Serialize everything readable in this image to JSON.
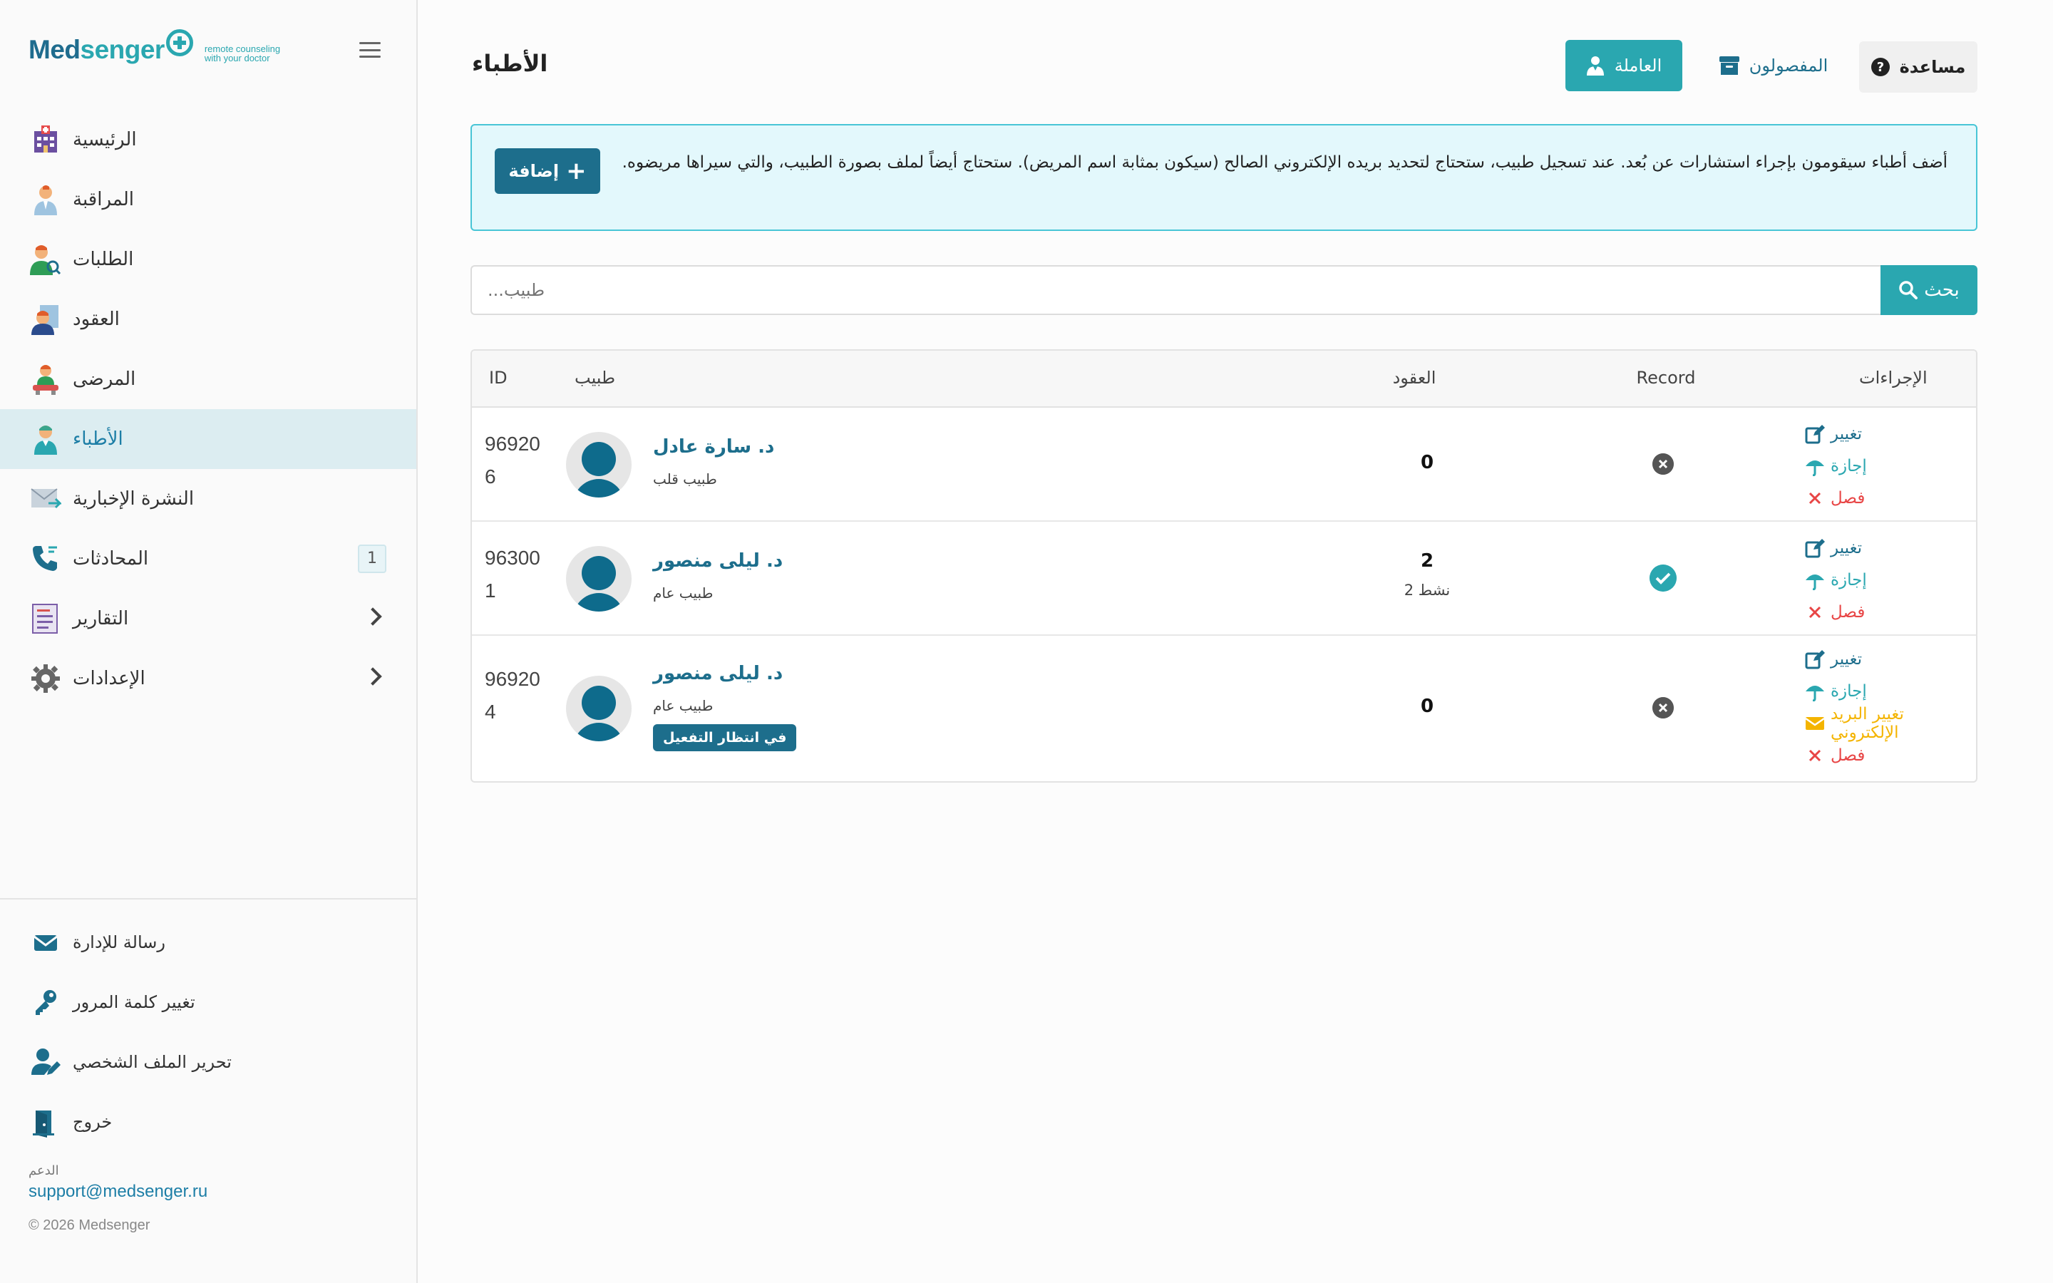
{
  "brand": {
    "word_a": "Med",
    "word_b": "senger",
    "tagline_1": "remote counseling",
    "tagline_2": "with your doctor"
  },
  "nav": [
    {
      "label": "الرئيسية",
      "icon": "hospital-icon"
    },
    {
      "label": "المراقبة",
      "icon": "monitoring-doctor-icon"
    },
    {
      "label": "الطلبات",
      "icon": "requests-icon"
    },
    {
      "label": "العقود",
      "icon": "contracts-icon"
    },
    {
      "label": "المرضى",
      "icon": "patients-icon"
    },
    {
      "label": "الأطباء",
      "icon": "doctors-icon",
      "active": true
    },
    {
      "label": "النشرة الإخبارية",
      "icon": "newsletter-icon"
    },
    {
      "label": "المحادثات",
      "icon": "phone-icon",
      "badge": "1"
    },
    {
      "label": "التقارير",
      "icon": "reports-icon"
    },
    {
      "label": "الإعدادات",
      "icon": "settings-icon"
    }
  ],
  "bottom_nav": [
    {
      "label": "رسالة للإدارة",
      "icon": "envelope-icon"
    },
    {
      "label": "تغيير كلمة المرور",
      "icon": "key-icon"
    },
    {
      "label": "تحرير الملف الشخصي",
      "icon": "user-edit-icon"
    },
    {
      "label": "خروج",
      "icon": "logout-door-icon"
    }
  ],
  "support": {
    "label": "الدعم",
    "email": "support@medsenger.ru",
    "copyright": "© 2026 Medsenger"
  },
  "header": {
    "title": "الأطباء",
    "btn_working": "العاملة",
    "btn_fired": "المفصولون",
    "btn_help": "مساعدة"
  },
  "alert": {
    "text": "أضف أطباء سيقومون بإجراء استشارات عن بُعد. عند تسجيل طبيب، ستحتاج لتحديد بريده الإلكتروني الصالح (سيكون بمثابة اسم المريض). ستحتاج أيضاً لملف بصورة الطبيب، والتي سيراها مريضوه.",
    "add_label": "إضافة"
  },
  "search": {
    "placeholder": "طبيب...",
    "button": "بحث"
  },
  "table": {
    "columns": {
      "id": "ID",
      "doctor": "طبيب",
      "contracts": "العقود",
      "record": "Record",
      "actions": "الإجراءات"
    },
    "rows": [
      {
        "id_1": "96920",
        "id_2": "6",
        "name": "د. سارة عادل",
        "spec": "طبيب قلب",
        "contracts": "0",
        "active": "",
        "record": false,
        "pending": "",
        "actions": {
          "edit": "تغيير",
          "vacation": "إجازة",
          "change_email": "",
          "fire": "فصل"
        }
      },
      {
        "id_1": "96300",
        "id_2": "1",
        "name": "د. ليلى منصور",
        "spec": "طبيب عام",
        "contracts": "2",
        "active": "نشط 2",
        "record": true,
        "pending": "",
        "actions": {
          "edit": "تغيير",
          "vacation": "إجازة",
          "change_email": "",
          "fire": "فصل"
        }
      },
      {
        "id_1": "96920",
        "id_2": "4",
        "name": "د. ليلى منصور",
        "spec": "طبيب عام",
        "contracts": "0",
        "active": "",
        "record": false,
        "pending": "في انتظار التفعيل",
        "actions": {
          "edit": "تغيير",
          "vacation": "إجازة",
          "change_email": "تغيير البريد الإلكتروني",
          "fire": "فصل"
        }
      }
    ]
  },
  "colors": {
    "teal": "#2aa7b0",
    "navy": "#1d6e8c",
    "danger": "#e84545",
    "warning": "#f4b400"
  }
}
